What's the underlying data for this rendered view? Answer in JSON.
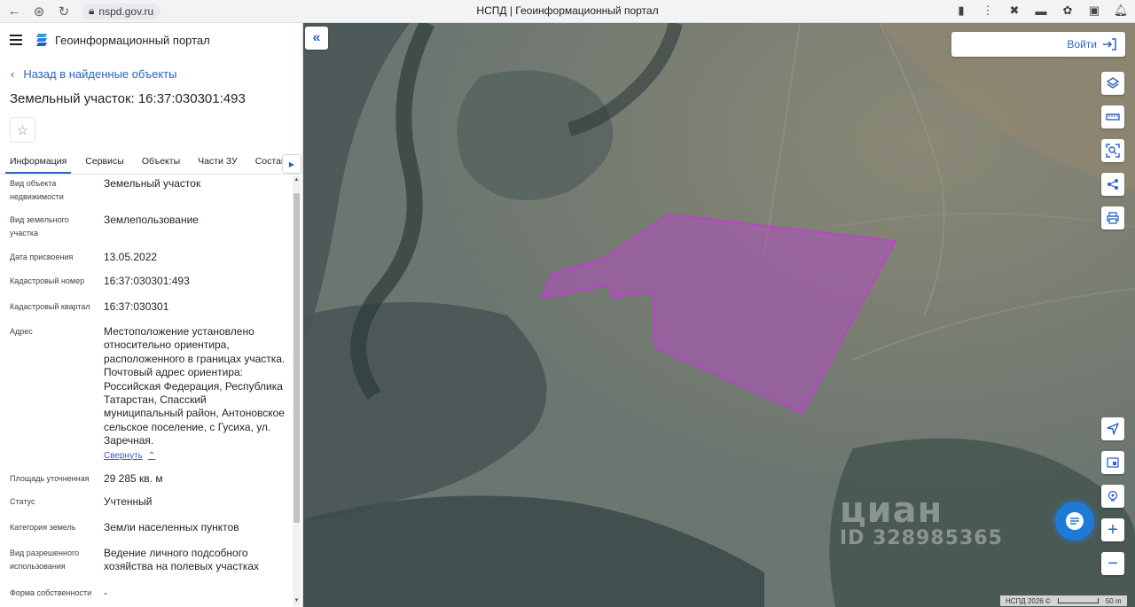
{
  "browser": {
    "url": "nspd.gov.ru",
    "tab_title": "НСПД | Геоинформационный портал"
  },
  "sidebar": {
    "portal_title": "Геоинформационный портал",
    "back_link": "Назад в найденные объекты",
    "object_title": "Земельный участок: 16:37:030301:493",
    "tabs": [
      "Информация",
      "Сервисы",
      "Объекты",
      "Части ЗУ",
      "Состав"
    ],
    "properties": [
      {
        "label": "Вид объекта недвижимости",
        "value": "Земельный участок"
      },
      {
        "label": "Вид земельного участка",
        "value": "Землепользование"
      },
      {
        "label": "Дата присвоения",
        "value": "13.05.2022"
      },
      {
        "label": "Кадастровый номер",
        "value": "16:37:030301:493"
      },
      {
        "label": "Кадастровый квартал",
        "value": "16:37:030301"
      },
      {
        "label": "Адрес",
        "value": "Местоположение установлено относительно ориентира, расположенного в границах участка. Почтовый адрес ориентира: Российская Федерация, Республика Татарстан, Спасский муниципальный район, Антоновское сельское поселение, с Гусиха, ул. Заречная."
      },
      {
        "label": "Площадь уточненная",
        "value": "29 285 кв. м"
      },
      {
        "label": "Статус",
        "value": "Учтенный"
      },
      {
        "label": "Категория земель",
        "value": "Земли населенных пунктов"
      },
      {
        "label": "Вид разрешенного использования",
        "value": "Ведение личного подсобного хозяйства на полевых участках"
      },
      {
        "label": "Форма собственности",
        "value": "-"
      }
    ],
    "collapse_label": "Свернуть"
  },
  "map": {
    "login_label": "Войти",
    "watermark_brand": "циан",
    "watermark_id": "ID 328985365",
    "copyright": "НСПД 2026 ©",
    "scale_label": "50 m",
    "parcel_color": "#b04fc0"
  }
}
